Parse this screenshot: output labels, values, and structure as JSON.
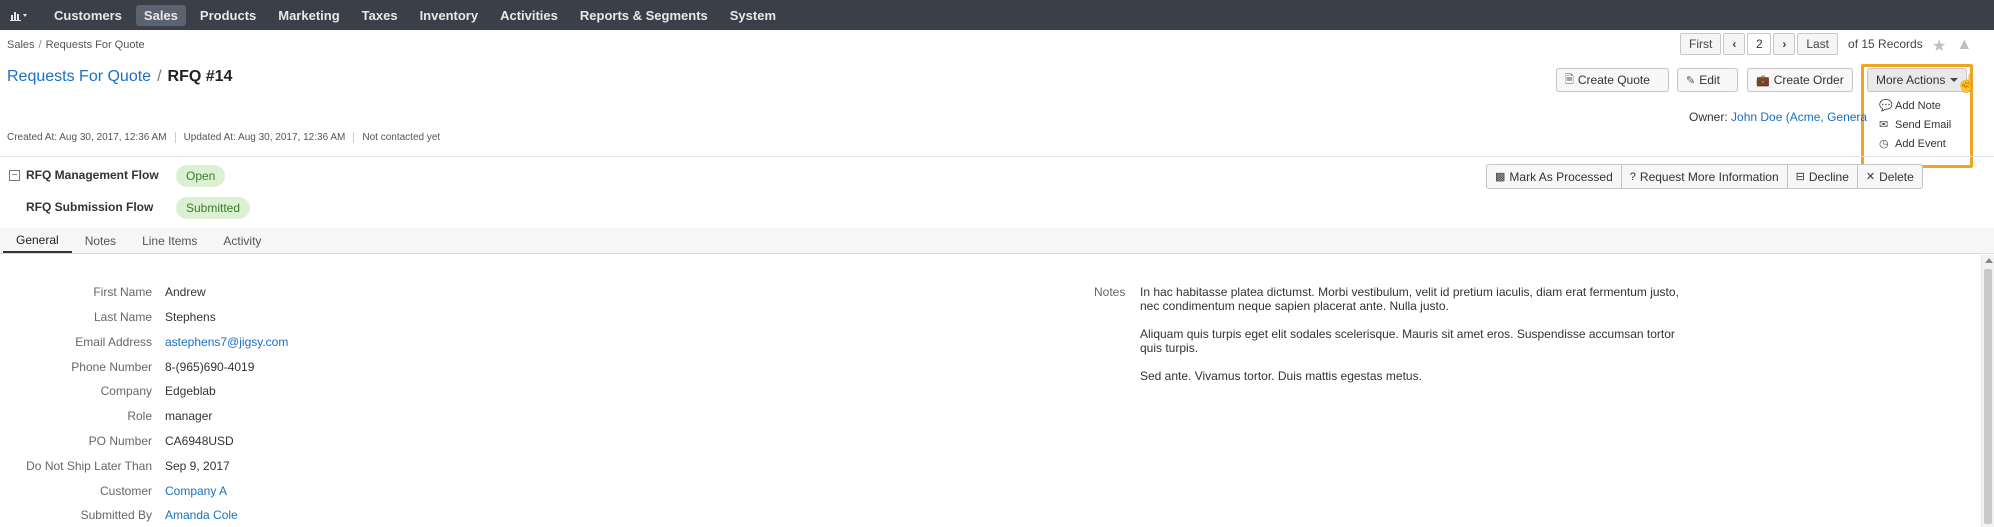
{
  "nav": {
    "items": [
      "Customers",
      "Sales",
      "Products",
      "Marketing",
      "Taxes",
      "Inventory",
      "Activities",
      "Reports & Segments",
      "System"
    ],
    "active": "Sales"
  },
  "breadcrumb": [
    "Sales",
    "Requests For Quote"
  ],
  "pagination": {
    "first": "First",
    "current": "2",
    "last": "Last",
    "total": "of 15 Records"
  },
  "title": {
    "parent": "Requests For Quote",
    "current": "RFQ #14"
  },
  "actions": {
    "create_quote": "Create Quote",
    "edit": "Edit",
    "create_order": "Create Order",
    "more_actions": "More Actions"
  },
  "more_actions_menu": [
    {
      "label": "Add Note",
      "icon": "comment-icon"
    },
    {
      "label": "Send Email",
      "icon": "envelope-icon"
    },
    {
      "label": "Add Event",
      "icon": "clock-icon"
    }
  ],
  "owner": {
    "label": "Owner:",
    "value": "John Doe (Acme, Genera"
  },
  "meta": {
    "created": "Created At: Aug 30, 2017, 12:36 AM",
    "updated": "Updated At: Aug 30, 2017, 12:36 AM",
    "contact": "Not contacted yet"
  },
  "workflows": [
    {
      "name": "RFQ Management Flow",
      "status": "Open"
    },
    {
      "name": "RFQ Submission Flow",
      "status": "Submitted"
    }
  ],
  "workflow_actions": {
    "mark_processed": "Mark As Processed",
    "request_info": "Request More Information",
    "decline": "Decline",
    "delete": "Delete"
  },
  "tabs": [
    "General",
    "Notes",
    "Line Items",
    "Activity"
  ],
  "fields": [
    {
      "label": "First Name",
      "value": "Andrew",
      "link": false
    },
    {
      "label": "Last Name",
      "value": "Stephens",
      "link": false
    },
    {
      "label": "Email Address",
      "value": "astephens7@jigsy.com",
      "link": true
    },
    {
      "label": "Phone Number",
      "value": "8-(965)690-4019",
      "link": false
    },
    {
      "label": "Company",
      "value": "Edgeblab",
      "link": false
    },
    {
      "label": "Role",
      "value": "manager",
      "link": false
    },
    {
      "label": "PO Number",
      "value": "CA6948USD",
      "link": false
    },
    {
      "label": "Do Not Ship Later Than",
      "value": "Sep 9, 2017",
      "link": false
    },
    {
      "label": "Customer",
      "value": "Company A",
      "link": true
    },
    {
      "label": "Submitted By",
      "value": "Amanda Cole",
      "link": true
    }
  ],
  "notes": {
    "label": "Notes",
    "paragraphs": [
      "In hac habitasse platea dictumst. Morbi vestibulum, velit id pretium iaculis, diam erat fermentum justo, nec condimentum neque sapien placerat ante. Nulla justo.",
      "Aliquam quis turpis eget elit sodales scelerisque. Mauris sit amet eros. Suspendisse accumsan tortor quis turpis.",
      "Sed ante. Vivamus tortor. Duis mattis egestas metus."
    ]
  },
  "colors": {
    "nav_bg": "#3a3f48",
    "link": "#1a6fc4",
    "status_bg": "#dcf1d4",
    "status_text": "#3d7b2b",
    "highlight": "#f0a51e"
  }
}
